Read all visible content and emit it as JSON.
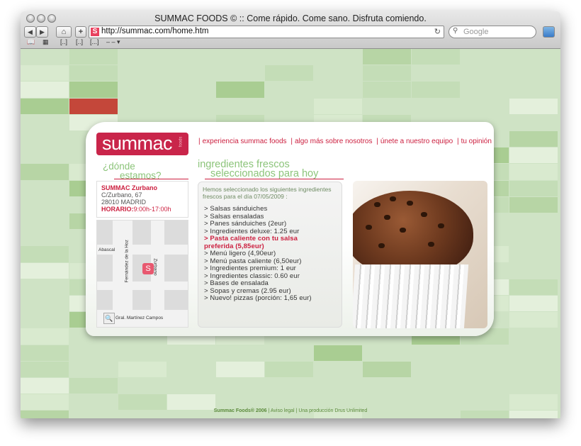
{
  "window": {
    "title": "SUMMAC FOODS © :: Come rápido. Come sano. Disfruta comiendo."
  },
  "toolbar": {
    "back_label": "◀",
    "forward_label": "▶",
    "home_label": "⌂",
    "add_label": "+",
    "favicon_label": "S",
    "url": "http://summac.com/home.htm",
    "reload_label": "↻",
    "search_placeholder": "Google",
    "bookmarks_bar": [
      "[..]",
      "[..]",
      "[...]",
      "– – ▾"
    ]
  },
  "logo": {
    "text": "summac",
    "tag": "foods"
  },
  "nav": {
    "items": [
      "experiencia summac foods",
      "algo más sobre nosotros",
      "únete a nuestro equipo",
      "tu opinión"
    ]
  },
  "location": {
    "heading_line1": "¿dónde",
    "heading_line2": "estamos?",
    "name": "SUMMAC Zurbano",
    "street": "C/Zurbano, 67",
    "city": "28010 MADRID",
    "hours_label": "HORARIO:",
    "hours_value": "9:00h-17:00h"
  },
  "map": {
    "streets": [
      "Abascal",
      "Fernández de la Hoz",
      "Zurbano",
      "Gral. Martínez Campos"
    ],
    "pin_label": "S",
    "zoom_label": "🔍"
  },
  "menu": {
    "heading_line1": "ingredientes frescos",
    "heading_line2": "seleccionados para hoy",
    "intro": "Hemos seleccionado los siguientes ingredientes frescos para el día 07/05/2009 :",
    "items": [
      "> Salsas sánduiches",
      "> Salsas ensaladas",
      "> Panes sánduiches (2eur)",
      "> Ingredientes deluxe: 1.25 eur",
      "> Pasta caliente con tu salsa preferida (5,85eur)",
      "> Menú ligero (4,90eur)",
      "> Menú pasta caliente (6,50eur)",
      "> Ingredientes premium: 1 eur",
      "> Ingredientes classic: 0.60 eur",
      "> Bases de ensalada",
      "> Sopas y cremas (2.95 eur)",
      "> Nuevo! pizzas (porción: 1,65 eur)"
    ]
  },
  "footer": {
    "brand": "Summac Foods® 2006",
    "legal": "Aviso legal",
    "credit": "Una producción Drus Unlimited"
  },
  "colors": {
    "accent_red": "#cc1f3f",
    "logo_bg": "#c9254a",
    "heading_green": "#8cc47a",
    "page_green": "#cfe3c5"
  }
}
